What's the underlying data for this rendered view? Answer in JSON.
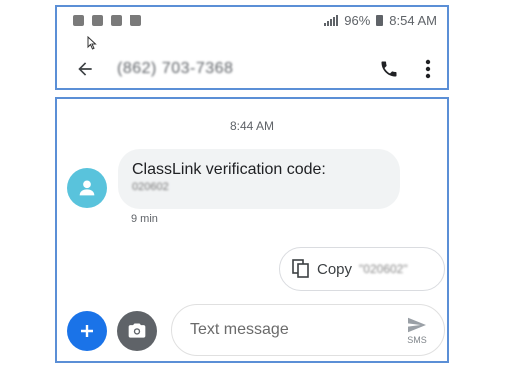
{
  "status_bar": {
    "notification_icons": [
      "notification-icon",
      "notification-icon",
      "notification-icon",
      "notification-icon"
    ],
    "signal_icon": "signal-icon",
    "battery_percent": "96%",
    "battery_icon": "battery-icon",
    "time": "8:54 AM"
  },
  "app_bar": {
    "back_icon": "back-arrow-icon",
    "contact_title": "(862) 703-7368",
    "call_icon": "phone-icon",
    "more_icon": "more-vert-icon"
  },
  "conversation": {
    "timestamp": "8:44 AM",
    "message": {
      "text": "ClassLink verification code:",
      "code": "020602",
      "age": "9 min",
      "avatar_color": "#59c3dc"
    },
    "copy_suggestion": {
      "label": "Copy",
      "code": "\"020602\""
    }
  },
  "composer": {
    "add_icon": "plus-icon",
    "add_color": "#1a73e8",
    "camera_icon": "camera-icon",
    "placeholder": "Text message",
    "send_icon": "send-icon",
    "send_label": "SMS"
  },
  "colors": {
    "panel_border": "#5b8fd6",
    "bubble_bg": "#f1f3f4"
  }
}
